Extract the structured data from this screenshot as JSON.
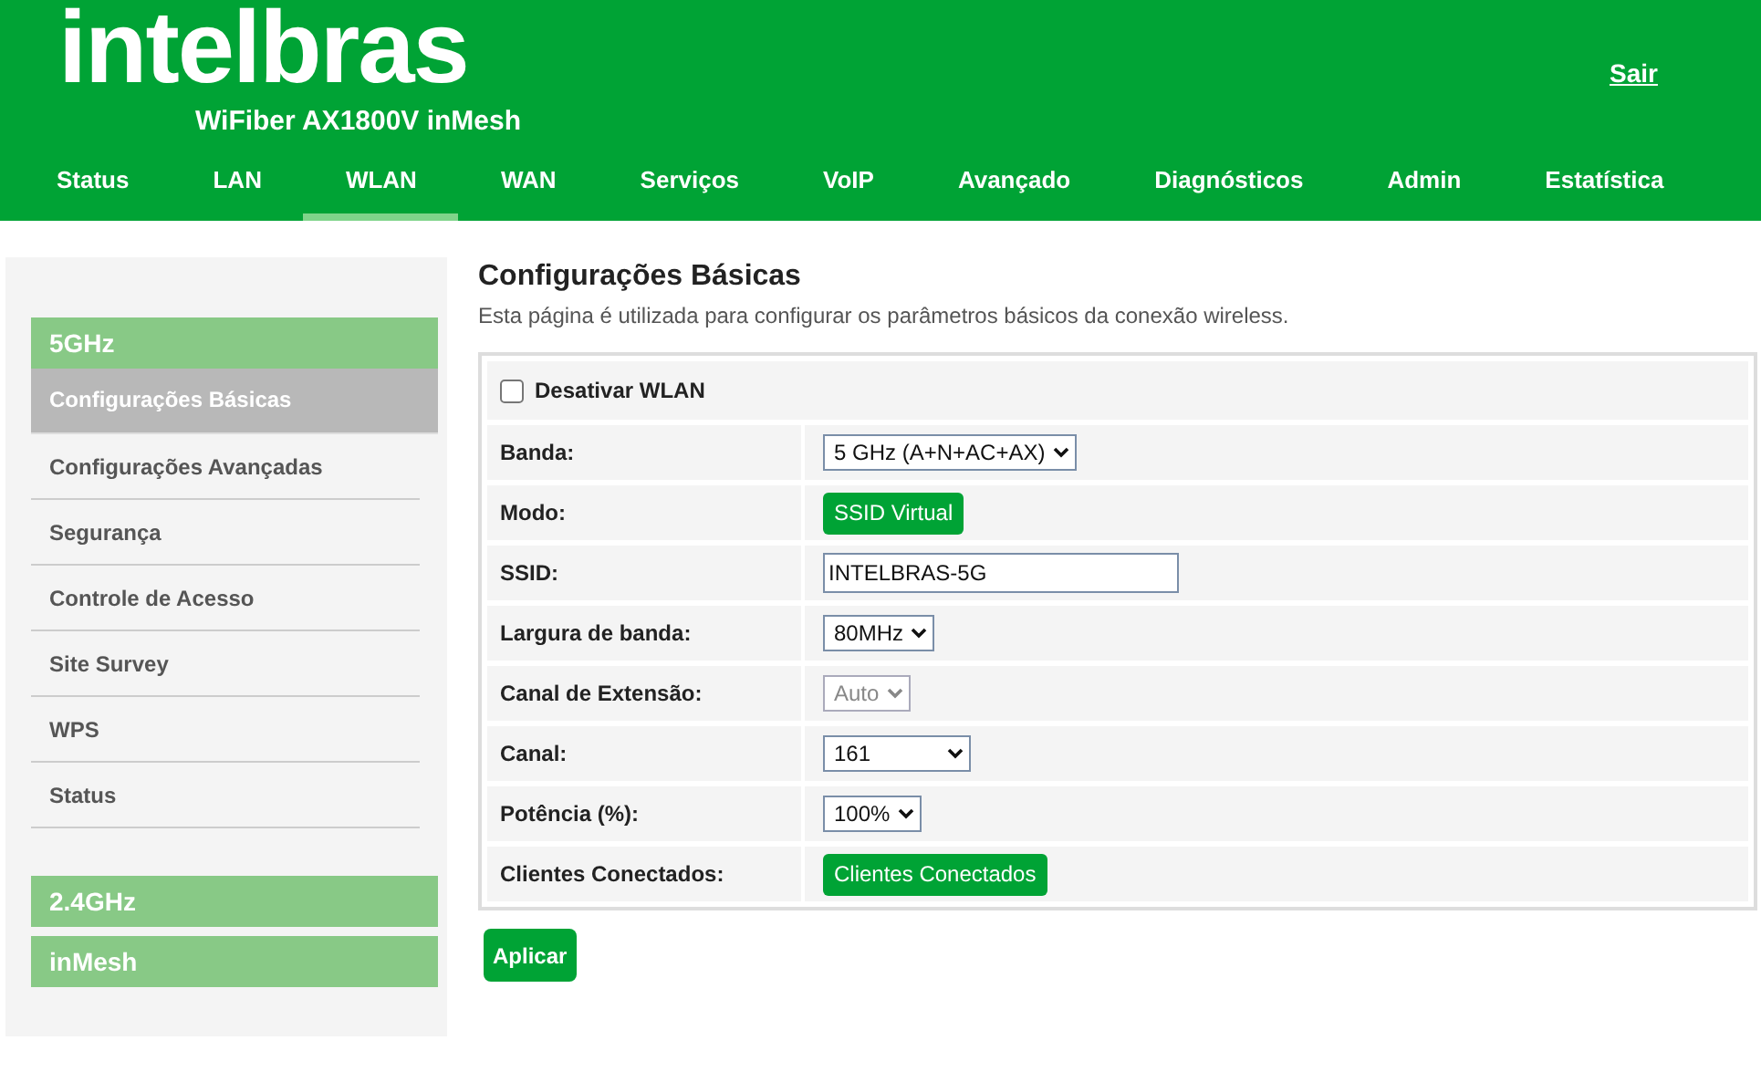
{
  "header": {
    "logo": "intelbras",
    "model": "WiFiber AX1800V inMesh",
    "logout": "Sair"
  },
  "nav": [
    {
      "label": "Status",
      "selected": false
    },
    {
      "label": "LAN",
      "selected": false
    },
    {
      "label": "WLAN",
      "selected": true
    },
    {
      "label": "WAN",
      "selected": false
    },
    {
      "label": "Serviços",
      "selected": false
    },
    {
      "label": "VoIP",
      "selected": false
    },
    {
      "label": "Avançado",
      "selected": false
    },
    {
      "label": "Diagnósticos",
      "selected": false
    },
    {
      "label": "Admin",
      "selected": false
    },
    {
      "label": "Estatística",
      "selected": false
    }
  ],
  "sidebar": [
    {
      "label": "5GHz",
      "items": [
        {
          "label": "Configurações Básicas",
          "selected": true
        },
        {
          "label": "Configurações Avançadas",
          "selected": false
        },
        {
          "label": "Segurança",
          "selected": false
        },
        {
          "label": "Controle de Acesso",
          "selected": false
        },
        {
          "label": "Site Survey",
          "selected": false
        },
        {
          "label": "WPS",
          "selected": false
        },
        {
          "label": "Status",
          "selected": false
        }
      ]
    },
    {
      "label": "2.4GHz"
    },
    {
      "label": "inMesh"
    }
  ],
  "page": {
    "title": "Configurações Básicas",
    "description": "Esta página é utilizada para configurar os parâmetros básicos da conexão wireless."
  },
  "disable_wlan": {
    "label": "Desativar WLAN",
    "checked": false
  },
  "fields": [
    {
      "label": "Banda:",
      "kind": "select",
      "value": "5 GHz (A+N+AC+AX)",
      "disabled": false
    },
    {
      "label": "Modo:",
      "kind": "button",
      "value": "SSID Virtual"
    },
    {
      "label": "SSID:",
      "kind": "text",
      "value": "INTELBRAS-5G"
    },
    {
      "label": "Largura de banda:",
      "kind": "select",
      "value": "80MHz",
      "disabled": false
    },
    {
      "label": "Canal de Extensão:",
      "kind": "select",
      "value": "Auto",
      "disabled": true
    },
    {
      "label": "Canal:",
      "kind": "select",
      "value": "161",
      "disabled": false,
      "wide": true
    },
    {
      "label": "Potência (%):",
      "kind": "select",
      "value": "100%",
      "disabled": false
    },
    {
      "label": "Clientes Conectados:",
      "kind": "button",
      "value": "Clientes Conectados"
    }
  ],
  "apply": "Aplicar"
}
